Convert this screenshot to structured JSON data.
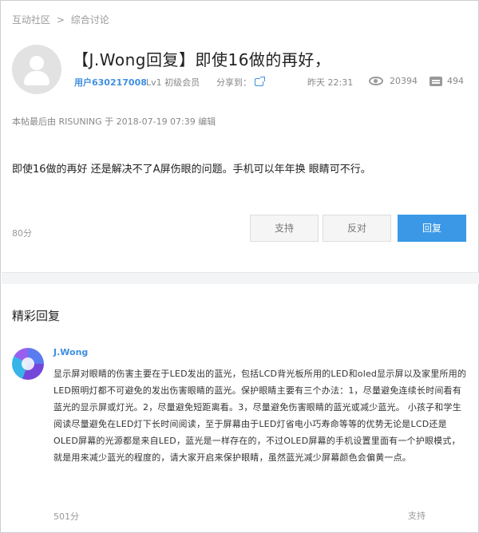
{
  "breadcrumb": {
    "root": "互动社区",
    "separator": ">",
    "current": "综合讨论"
  },
  "post": {
    "title": "【J.Wong回复】即使16做的再好，",
    "author": "用户630217008",
    "level": "Lv1 初级会员",
    "share_label": "分享到：",
    "time": "昨天 22:31",
    "views": "20394",
    "replies": "494",
    "edit_note": "本帖最后由 RISUNING 于 2018-07-19 07:39 编辑",
    "body": "即使16做的再好 还是解决不了A屏伤眼的问题。手机可以年年换 眼睛可不行。",
    "score": "80分"
  },
  "actions": {
    "support": "支持",
    "oppose": "反对",
    "reply": "回复"
  },
  "featured": {
    "section_title": "精彩回复",
    "author": "J.Wong",
    "text": "显示屏对眼睛的伤害主要在于LED发出的蓝光，包括LCD背光板所用的LED和oled显示屏以及家里所用的LED照明灯都不可避免的发出伤害眼睛的蓝光。保护眼睛主要有三个办法：1，尽量避免连续长时间看有蓝光的显示屏或灯光。2，尽量避免短距离看。3，尽量避免伤害眼睛的蓝光或减少蓝光。 小孩子和学生阅读尽量避免在LED灯下长时间阅读，至于屏幕由于LED灯省电小巧寿命等等的优势无论是LCD还是OLED屏幕的光源都是来自LED，蓝光是一样存在的，不过OLED屏幕的手机设置里面有一个护眼模式，就是用来减少蓝光的程度的，请大家开启来保护眼睛，虽然蓝光减少屏幕颜色会偏黄一点。",
    "score": "501分",
    "support": "支持"
  },
  "icons": {
    "avatar": "default-user-avatar",
    "share": "share-external-icon",
    "views": "eye-icon",
    "replies": "comment-icon"
  },
  "colors": {
    "accent": "#3a98e6",
    "link": "#3f8fe0"
  }
}
